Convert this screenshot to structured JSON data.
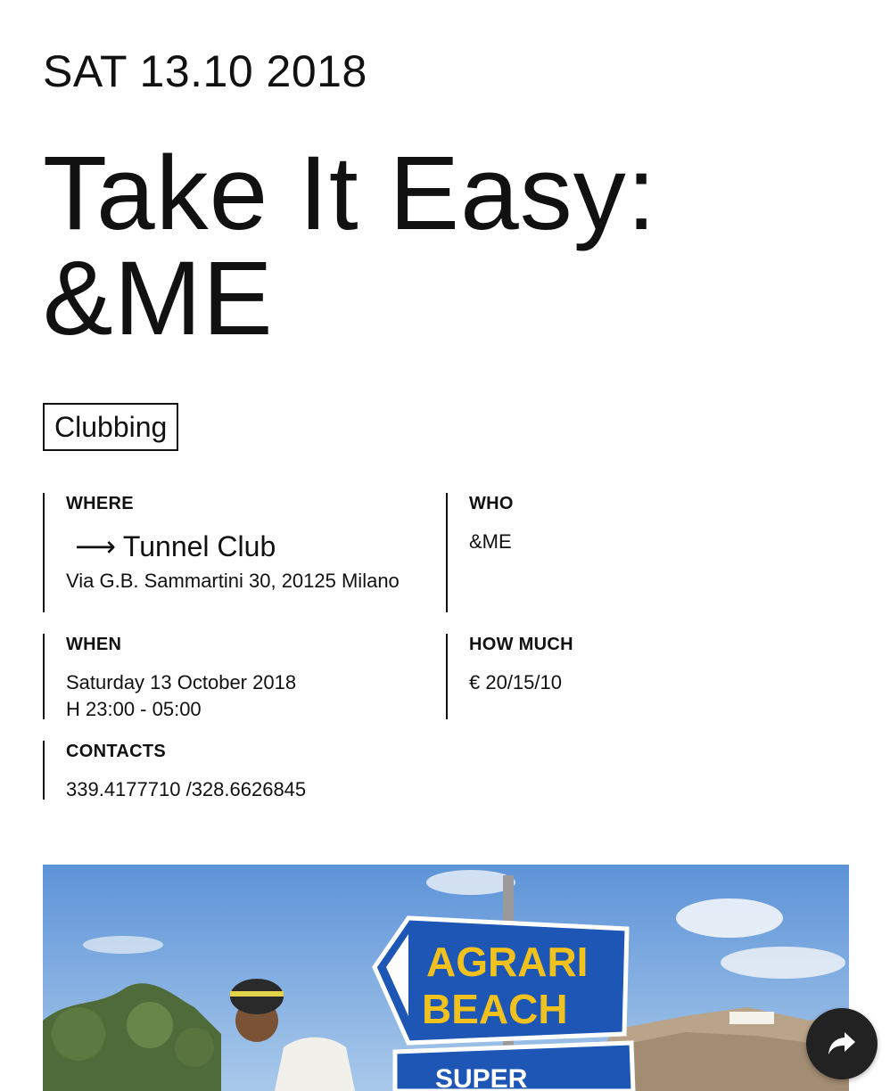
{
  "event": {
    "date_line": "SAT 13.10 2018",
    "title_line1": "Take It Easy:",
    "title_line2": "&ME",
    "tag": "Clubbing"
  },
  "where": {
    "label": "WHERE",
    "arrow": "⟶",
    "venue": "Tunnel Club",
    "address": "Via G.B. Sammartini 30, 20125 Milano"
  },
  "who": {
    "label": "WHO",
    "value": "&ME"
  },
  "when": {
    "label": "WHEN",
    "date": "Saturday 13 October 2018",
    "hours": "H 23:00 - 05:00"
  },
  "how_much": {
    "label": "HOW MUCH",
    "value": "€ 20/15/10"
  },
  "contacts": {
    "label": "CONTACTS",
    "value": "339.4177710 /328.6626845"
  },
  "photo": {
    "sign_line1": "AGRARI",
    "sign_line2": "BEACH",
    "sign_line3": "SUPER"
  },
  "share_button": {
    "icon": "share-arrow-icon"
  }
}
